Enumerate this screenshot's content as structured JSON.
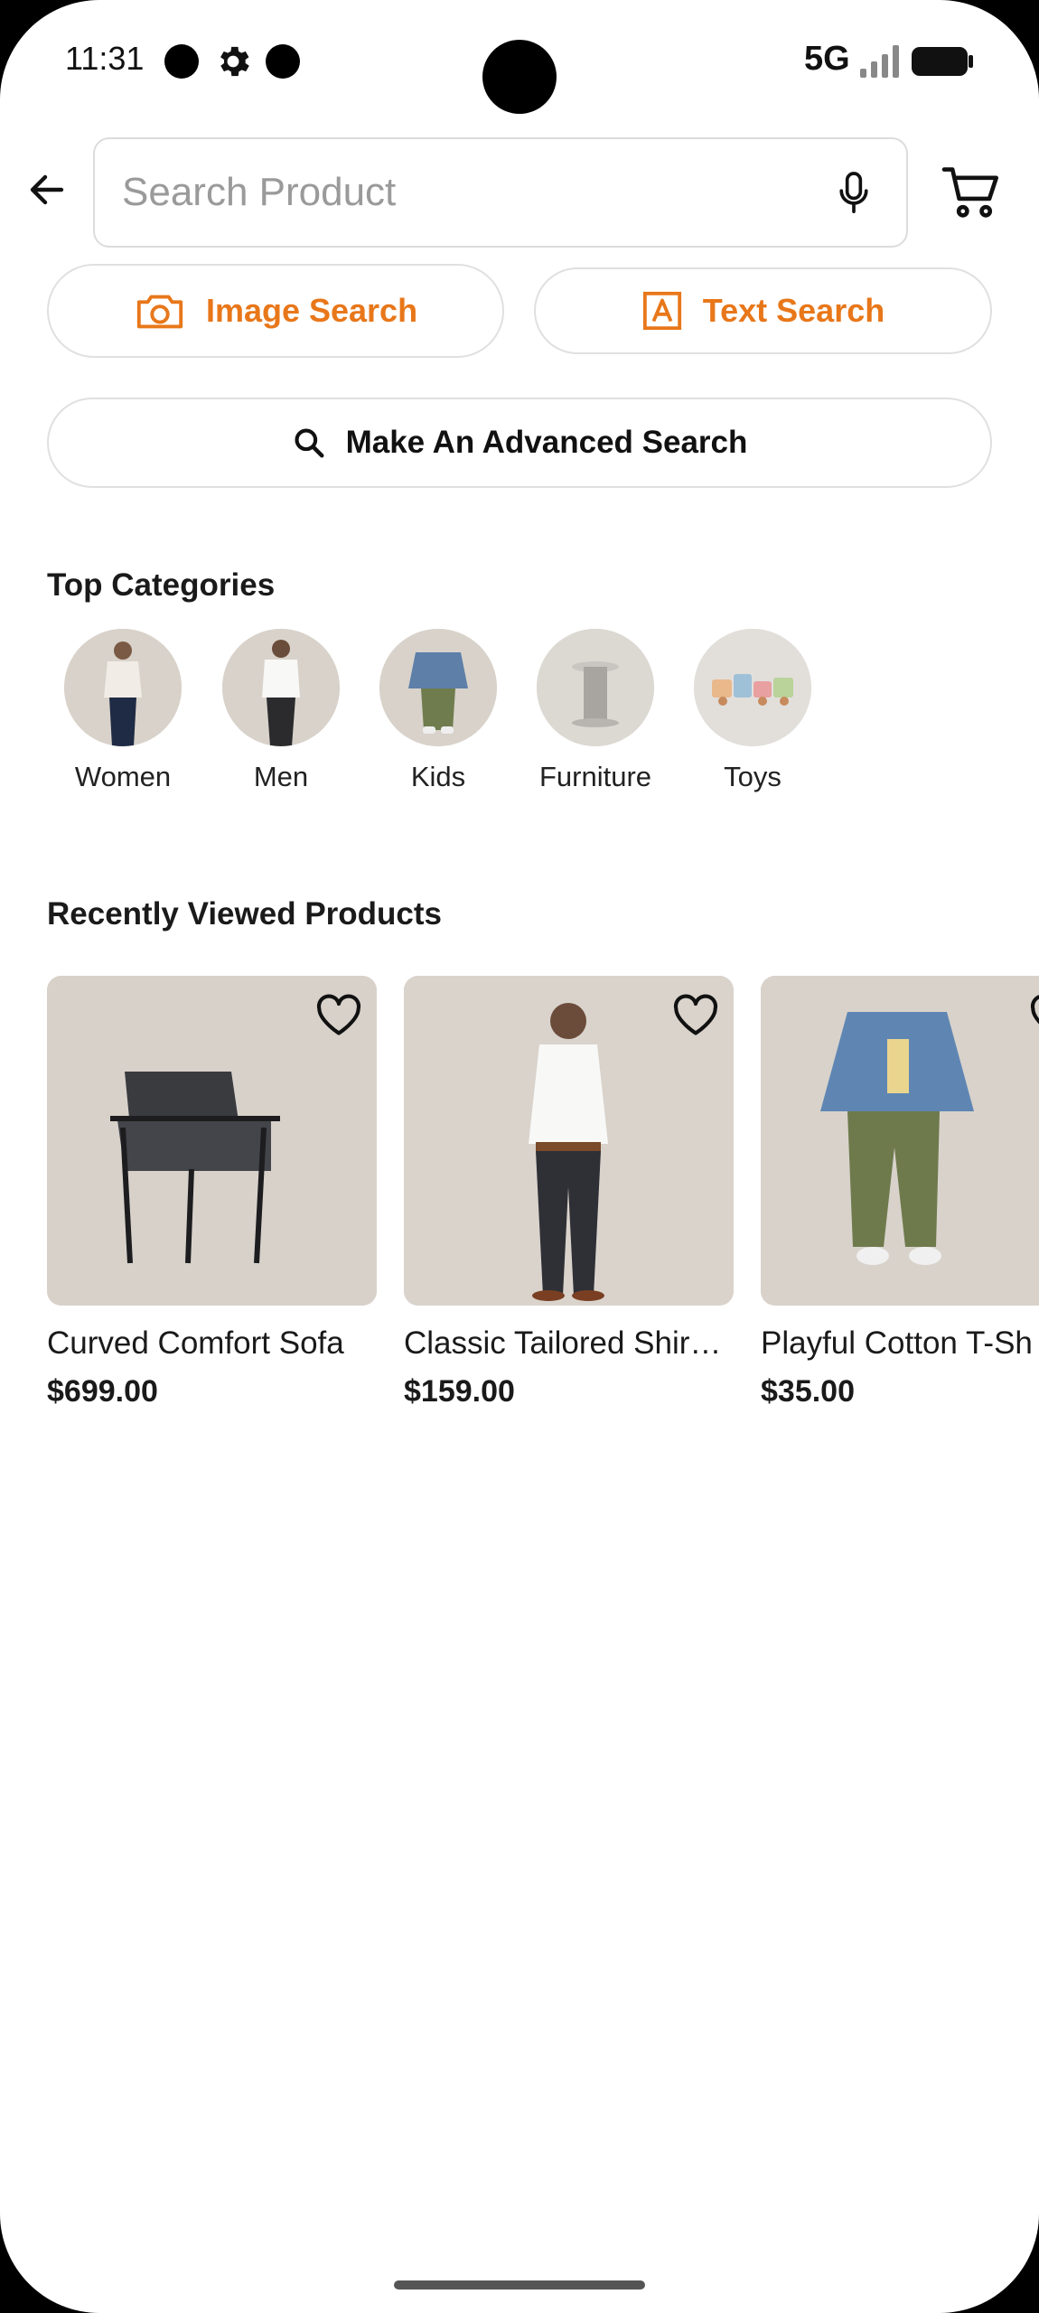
{
  "status_bar": {
    "time": "11:31",
    "network": "5G",
    "icons": [
      "notification-dot-icon",
      "gear-icon",
      "notification-dot-icon",
      "signal-icon",
      "battery-icon"
    ]
  },
  "search": {
    "placeholder": "Search Product",
    "value": ""
  },
  "search_modes": {
    "image_search": "Image Search",
    "text_search": "Text Search",
    "advanced_search": "Make An Advanced Search"
  },
  "categories": {
    "title": "Top Categories",
    "items": [
      {
        "label": "Women"
      },
      {
        "label": "Men"
      },
      {
        "label": "Kids"
      },
      {
        "label": "Furniture"
      },
      {
        "label": "Toys"
      }
    ]
  },
  "recent": {
    "title": "Recently Viewed Products",
    "items": [
      {
        "name": "Curved Comfort Sofa",
        "price": "$699.00"
      },
      {
        "name": "Classic Tailored Shir…",
        "price": "$159.00"
      },
      {
        "name": "Playful Cotton T-Sh",
        "price": "$35.00"
      }
    ]
  },
  "colors": {
    "accent": "#e8771a",
    "border": "#dcdcdc",
    "text": "#1a1a1a"
  }
}
